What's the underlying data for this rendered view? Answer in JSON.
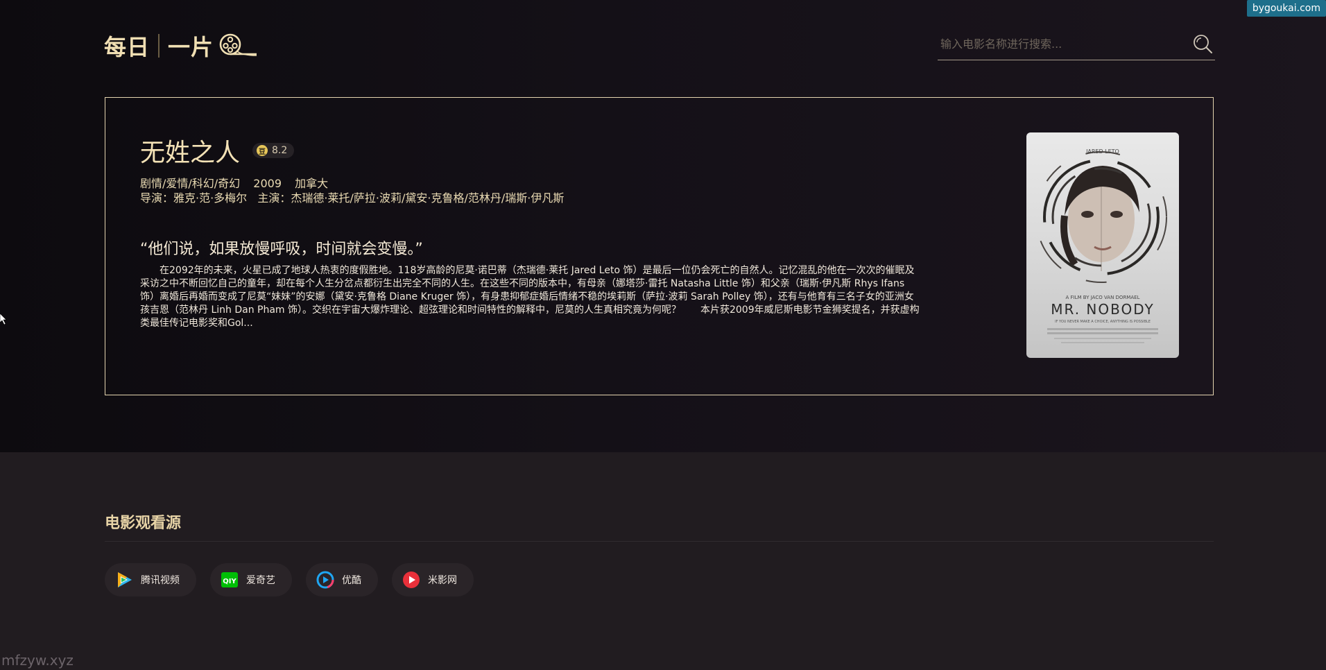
{
  "header": {
    "logo_text_1": "每日",
    "logo_text_2": "一片",
    "search_placeholder": "输入电影名称进行搜索..."
  },
  "movie": {
    "title": "无姓之人",
    "rating": "8.2",
    "rating_badge_glyph": "豆",
    "genres": "剧情/爱情/科幻/奇幻",
    "year": "2009",
    "country": "加拿大",
    "credits": "导演：雅克·范·多梅尔   主演：杰瑞德·莱托/萨拉·波莉/黛安·克鲁格/范林丹/瑞斯·伊凡斯",
    "quote": "“他们说，如果放慢呼吸，时间就会变慢。”",
    "description": "在2092年的未来，火星已成了地球人热衷的度假胜地。118岁高龄的尼莫·诺巴蒂（杰瑞德·莱托 Jared Leto 饰）是最后一位仍会死亡的自然人。记忆混乱的他在一次次的催眠及采访之中不断回忆自己的童年，却在每个人生分岔点都衍生出完全不同的人生。在这些不同的版本中，有母亲（娜塔莎·雷托 Natasha Little 饰）和父亲（瑞斯·伊凡斯 Rhys Ifans 饰）离婚后再婚而变成了尼莫“妹妹”的安娜（黛安·克鲁格 Diane Kruger 饰），有身患抑郁症婚后情绪不稳的埃莉斯（萨拉·波莉 Sarah Polley 饰），还有与他育有三名子女的亚洲女孩吉恩（范林丹 Linh Dan Pham 饰）。交织在宇宙大爆炸理论、超弦理论和时间特性的解释中，尼莫的人生真相究竟为何呢？　　本片获2009年威尼斯电影节金狮奖提名，并获虚构类最佳传记电影奖和Gol...",
    "poster": {
      "credit_top": "JARED LETO",
      "film_by": "A FILM BY JACO VAN DORMAEL",
      "title": "MR. NOBODY",
      "tagline": "IF YOU NEVER MAKE A CHOICE, ANYTHING IS POSSIBLE"
    }
  },
  "sources": {
    "title": "电影观看源",
    "items": [
      {
        "label": "腾讯视频",
        "icon": "tencent-video-icon"
      },
      {
        "label": "爱奇艺",
        "icon": "iqiyi-icon"
      },
      {
        "label": "优酷",
        "icon": "youku-icon"
      },
      {
        "label": "米影网",
        "icon": "miying-icon"
      }
    ]
  },
  "watermarks": {
    "top_right": "bygoukai.com",
    "bottom_left": "mfzyw.xyz"
  }
}
